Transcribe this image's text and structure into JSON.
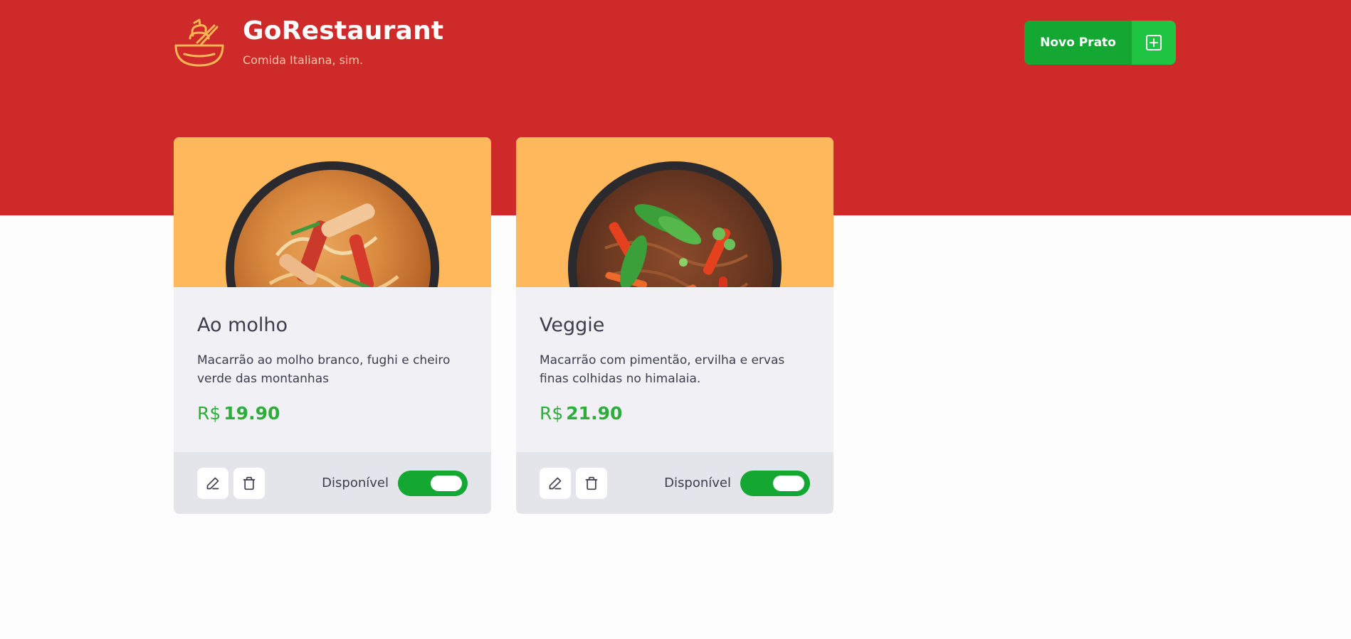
{
  "brand": {
    "title": "GoRestaurant",
    "subtitle": "Comida Italiana, sim.",
    "logo_icon": "bowl-icon",
    "accent": "#f7b654"
  },
  "header": {
    "background": "#cf2a2a",
    "new_button_label": "Novo Prato",
    "new_button_icon": "plus-square-icon"
  },
  "dishes": [
    {
      "name": "Ao molho",
      "description": "Macarrão ao molho branco, fughi e cheiro verde das montanhas",
      "currency": "R$",
      "price": "19.90",
      "available_label": "Disponível",
      "available": true
    },
    {
      "name": "Veggie",
      "description": "Macarrão com pimentão, ervilha e ervas finas colhidas no himalaia.",
      "currency": "R$",
      "price": "21.90",
      "available_label": "Disponível",
      "available": true
    }
  ],
  "colors": {
    "green": "#14a832",
    "price": "#2bae3a",
    "card": "#f0f0f5",
    "card_footer": "#e4e4eb",
    "image_bg": "#ffb85c"
  }
}
